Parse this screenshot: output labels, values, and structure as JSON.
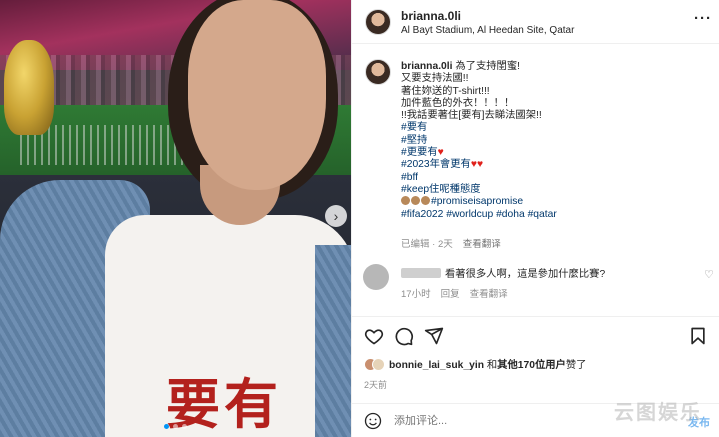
{
  "post": {
    "username": "brianna.0li",
    "location": "Al Bayt Stadium, Al Heedan Site, Qatar",
    "more_icon": "more-horizontal-icon",
    "shirt_text": "要有"
  },
  "caption": {
    "username": "brianna.0li",
    "l1": " 為了支持閨蜜!",
    "l2": "又要支持法國!!",
    "l3": "著住妳送的T-shirt!!!",
    "l4": "加件藍色的外衣！！！！",
    "l5": "!!我話要著住[要有]去睇法國架!!",
    "t1": "#要有",
    "t2": "#堅持",
    "t3": "#更要有",
    "t4": "#2023年會更有",
    "t5": "#bff",
    "t6": "#keep住呢種態度",
    "t7": "#promiseisapromise",
    "t8": "#fifa2022",
    "t9": "#worldcup",
    "t10": "#doha",
    "t11": "#qatar",
    "edited": "已编辑 · 2天",
    "translate": "查看翻译"
  },
  "comment": {
    "text": "看著很多人啊，這是參加什麼比賽?",
    "time": "17小时",
    "reply": "回复",
    "translate": "查看翻译"
  },
  "likes": {
    "liker": "bonnie_lai_suk_yin",
    "connector": " 和",
    "others": "其他170位用户",
    "suffix": "赞了"
  },
  "date": "2天前",
  "add_comment": {
    "placeholder": "添加评论...",
    "post_label": "发布"
  },
  "watermark": "云图娱乐",
  "colors": {
    "link": "#00376b",
    "heart": "#e0211b",
    "post_button": "#7ab8f0",
    "accent": "#0095f6"
  }
}
